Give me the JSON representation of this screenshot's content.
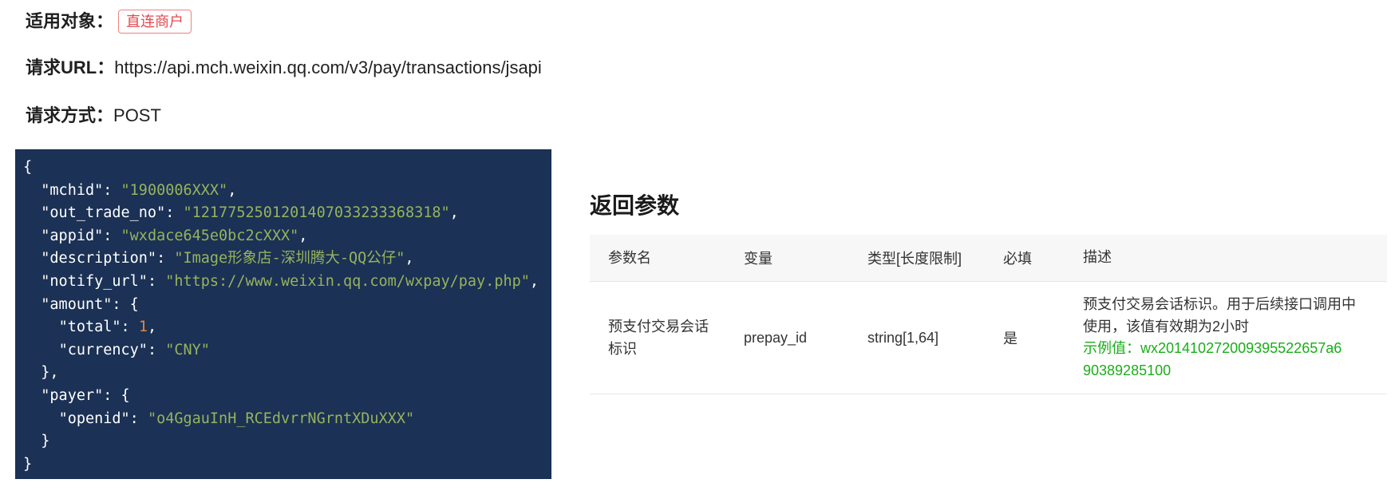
{
  "meta": {
    "target_label": "适用对象：",
    "target_tag": "直连商户",
    "url_label": "请求URL：",
    "url_value": "https://api.mch.weixin.qq.com/v3/pay/transactions/jsapi",
    "method_label": "请求方式：",
    "method_value": "POST"
  },
  "code": {
    "lines": [
      [
        [
          "p",
          "{"
        ]
      ],
      [
        [
          "p",
          "  "
        ],
        [
          "key",
          "\"mchid\""
        ],
        [
          "p",
          ": "
        ],
        [
          "str",
          "\"1900006XXX\""
        ],
        [
          "p",
          ","
        ]
      ],
      [
        [
          "p",
          "  "
        ],
        [
          "key",
          "\"out_trade_no\""
        ],
        [
          "p",
          ": "
        ],
        [
          "str",
          "\"1217752501201407033233368318\""
        ],
        [
          "p",
          ","
        ]
      ],
      [
        [
          "p",
          "  "
        ],
        [
          "key",
          "\"appid\""
        ],
        [
          "p",
          ": "
        ],
        [
          "str",
          "\"wxdace645e0bc2cXXX\""
        ],
        [
          "p",
          ","
        ]
      ],
      [
        [
          "p",
          "  "
        ],
        [
          "key",
          "\"description\""
        ],
        [
          "p",
          ": "
        ],
        [
          "str",
          "\"Image形象店-深圳腾大-QQ公仔\""
        ],
        [
          "p",
          ","
        ]
      ],
      [
        [
          "p",
          "  "
        ],
        [
          "key",
          "\"notify_url\""
        ],
        [
          "p",
          ": "
        ],
        [
          "str",
          "\"https://www.weixin.qq.com/wxpay/pay.php\""
        ],
        [
          "p",
          ","
        ]
      ],
      [
        [
          "p",
          "  "
        ],
        [
          "key",
          "\"amount\""
        ],
        [
          "p",
          ": {"
        ]
      ],
      [
        [
          "p",
          "    "
        ],
        [
          "key",
          "\"total\""
        ],
        [
          "p",
          ": "
        ],
        [
          "num",
          "1"
        ],
        [
          "p",
          ","
        ]
      ],
      [
        [
          "p",
          "    "
        ],
        [
          "key",
          "\"currency\""
        ],
        [
          "p",
          ": "
        ],
        [
          "str",
          "\"CNY\""
        ]
      ],
      [
        [
          "p",
          "  },"
        ]
      ],
      [
        [
          "p",
          "  "
        ],
        [
          "key",
          "\"payer\""
        ],
        [
          "p",
          ": {"
        ]
      ],
      [
        [
          "p",
          "    "
        ],
        [
          "key",
          "\"openid\""
        ],
        [
          "p",
          ": "
        ],
        [
          "str",
          "\"o4GgauInH_RCEdvrrNGrntXDuXXX\""
        ]
      ],
      [
        [
          "p",
          "  }"
        ]
      ],
      [
        [
          "p",
          "}"
        ]
      ]
    ]
  },
  "response": {
    "title": "返回参数",
    "headers": [
      "参数名",
      "变量",
      "类型[长度限制]",
      "必填",
      "描述"
    ],
    "rows": [
      {
        "name_line1": "预支付交易会话",
        "name_line2": "标识",
        "variable": "prepay_id",
        "type": "string[1,64]",
        "required": "是",
        "desc_line1": "预支付交易会话标识。用于后续接口调用中",
        "desc_line2": "使用，该值有效期为2小时",
        "example_line1": "示例值：wx201410272009395522657a6",
        "example_line2": "90389285100"
      }
    ]
  },
  "colors": {
    "code_bg": "#1b3155",
    "string": "#96b35d",
    "number": "#e8863b",
    "tag_red": "#e5484d",
    "example_green": "#1aad19"
  }
}
